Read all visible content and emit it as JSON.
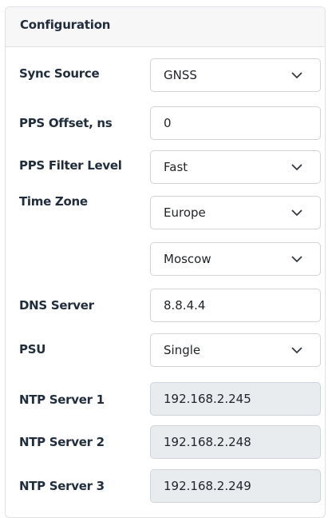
{
  "panel": {
    "title": "Configuration"
  },
  "rows": {
    "sync_source": {
      "label": "Sync Source",
      "value": "GNSS"
    },
    "pps_offset": {
      "label": "PPS Offset, ns",
      "value": "0"
    },
    "pps_filter": {
      "label": "PPS Filter Level",
      "value": "Fast"
    },
    "time_zone": {
      "label": "Time Zone",
      "region": "Europe",
      "city": "Moscow"
    },
    "dns_server": {
      "label": "DNS Server",
      "value": "8.8.4.4"
    },
    "psu": {
      "label": "PSU",
      "value": "Single"
    },
    "ntp1": {
      "label": "NTP Server 1",
      "value": "192.168.2.245"
    },
    "ntp2": {
      "label": "NTP Server 2",
      "value": "192.168.2.248"
    },
    "ntp3": {
      "label": "NTP Server 3",
      "value": "192.168.2.249"
    }
  },
  "icons": {
    "select": "chevron-down-icon"
  }
}
